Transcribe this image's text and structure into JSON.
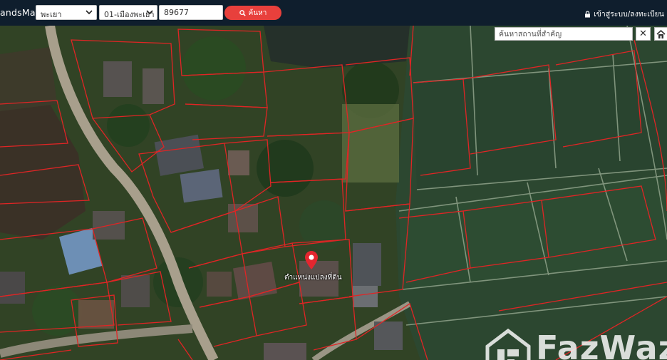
{
  "header": {
    "brand": "andsMaps",
    "province": "พะเยา",
    "district": "01-เมืองพะเยา",
    "parcel_number": "89677",
    "search_button": "ค้นหา",
    "login": "เข้าสู่ระบบ/ลงทะเบียน"
  },
  "map": {
    "place_search_placeholder": "ค้นหาสถานที่สำคัญ",
    "close_label": "✕",
    "marker_label": "ตำแหน่งแปลงที่ดิน",
    "watermark_text": "FazWaz",
    "colors": {
      "parcel_line": "#e02525",
      "marker": "#e3262f",
      "topbar": "#0f1e2d",
      "search_button": "#e8403c"
    }
  }
}
